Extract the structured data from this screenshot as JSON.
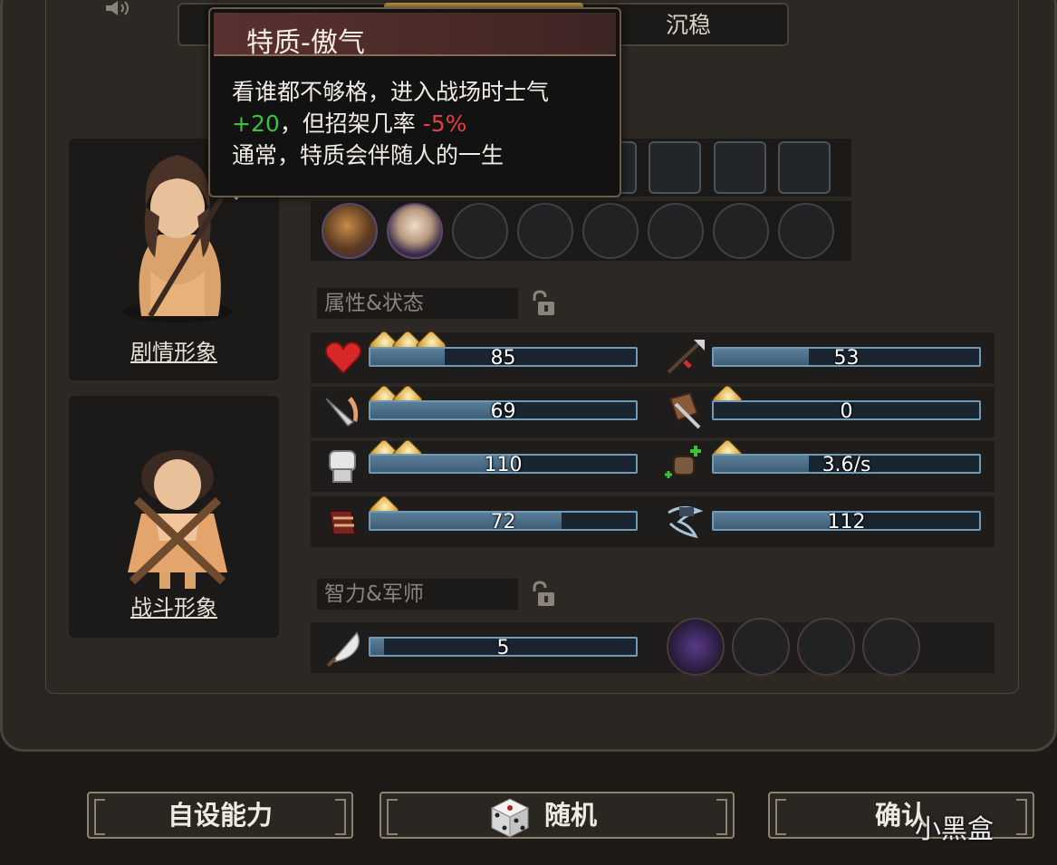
{
  "top_tabs": {
    "right_label": "沉稳"
  },
  "tooltip": {
    "title": "特质-傲气",
    "line1": "看谁都不够格，进入战场时士气",
    "bonus": "+20",
    "line2_mid": "，但招架几率 ",
    "penalty": "-5%",
    "line3": "通常，特质会伴随人的一生"
  },
  "portraits": {
    "story_label": "剧情形象",
    "battle_label": "战斗形象"
  },
  "sections": {
    "attributes_title": "属性&状态",
    "intellect_title": "智力&军师"
  },
  "stats": [
    {
      "icon": "heart-icon",
      "value": "85",
      "fill": 0.28,
      "pips": 3
    },
    {
      "icon": "arrow-icon",
      "value": "53",
      "fill": 0.36,
      "pips": 0
    },
    {
      "icon": "blade-icon",
      "value": "69",
      "fill": 0.47,
      "pips": 2
    },
    {
      "icon": "shield-sword-icon",
      "value": "0",
      "fill": 0.0,
      "pips": 1
    },
    {
      "icon": "fist-icon",
      "value": "110",
      "fill": 0.55,
      "pips": 2
    },
    {
      "icon": "fist-plus-icon",
      "value": "3.6/s",
      "fill": 0.36,
      "pips": 1
    },
    {
      "icon": "bracer-icon",
      "value": "72",
      "fill": 0.72,
      "pips": 1
    },
    {
      "icon": "whirlwind-icon",
      "value": "112",
      "fill": 0.44,
      "pips": 0
    }
  ],
  "intellect": {
    "icon": "feather-fan-icon",
    "value": "5",
    "fill": 0.05
  },
  "buttons": {
    "custom": "自设能力",
    "random": "随机",
    "confirm": "确认"
  },
  "watermark": "小黑盒",
  "colors": {
    "bar_border": "#6f9bb8",
    "bar_fill": "#4a6d86",
    "pip_gold": "#d9a53c",
    "bonus_green": "#3cc23c",
    "penalty_red": "#e24040"
  }
}
